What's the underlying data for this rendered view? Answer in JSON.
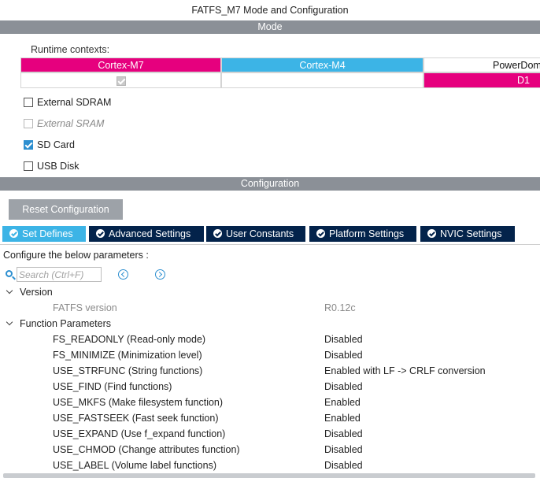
{
  "window": {
    "title": "FATFS_M7 Mode and Configuration"
  },
  "mode": {
    "header": "Mode",
    "runtime_label": "Runtime contexts:",
    "contexts": [
      "Cortex-M7",
      "Cortex-M4",
      "PowerDom"
    ],
    "cells": {
      "cortex_m7_checked": true,
      "power_domain_value": "D1"
    },
    "options": [
      {
        "label": "External SDRAM",
        "checked": false,
        "disabled": false
      },
      {
        "label": "External SRAM",
        "checked": false,
        "disabled": true
      },
      {
        "label": "SD Card",
        "checked": true,
        "disabled": false
      },
      {
        "label": "USB Disk",
        "checked": false,
        "disabled": false
      }
    ]
  },
  "configuration": {
    "header": "Configuration",
    "reset_button": "Reset Configuration",
    "tabs": [
      {
        "label": "Set Defines",
        "active": true
      },
      {
        "label": "Advanced Settings",
        "active": false
      },
      {
        "label": "User Constants",
        "active": false
      },
      {
        "label": "Platform Settings",
        "active": false
      },
      {
        "label": "NVIC Settings",
        "active": false
      }
    ],
    "instructions": "Configure the below parameters :",
    "search": {
      "placeholder": "Search (Ctrl+F)"
    },
    "groups": {
      "version": {
        "label": "Version",
        "params": [
          {
            "name": "FATFS version",
            "value": "R0.12c",
            "readonly": true
          }
        ]
      },
      "function_parameters": {
        "label": "Function Parameters",
        "params": [
          {
            "name": "FS_READONLY (Read-only mode)",
            "value": "Disabled"
          },
          {
            "name": "FS_MINIMIZE (Minimization level)",
            "value": "Disabled"
          },
          {
            "name": "USE_STRFUNC (String functions)",
            "value": "Enabled with LF -> CRLF conversion"
          },
          {
            "name": "USE_FIND (Find functions)",
            "value": "Disabled"
          },
          {
            "name": "USE_MKFS (Make filesystem function)",
            "value": "Enabled"
          },
          {
            "name": "USE_FASTSEEK (Fast seek function)",
            "value": "Enabled"
          },
          {
            "name": "USE_EXPAND (Use f_expand function)",
            "value": "Disabled"
          },
          {
            "name": "USE_CHMOD (Change attributes function)",
            "value": "Disabled"
          },
          {
            "name": "USE_LABEL (Volume label functions)",
            "value": "Disabled"
          }
        ]
      }
    }
  },
  "colors": {
    "accent_magenta": "#e6007e",
    "accent_cyan": "#3cb4e6",
    "tab_dark": "#03234b",
    "section_bar": "#8b9097",
    "check_blue": "#2d8fd0"
  }
}
